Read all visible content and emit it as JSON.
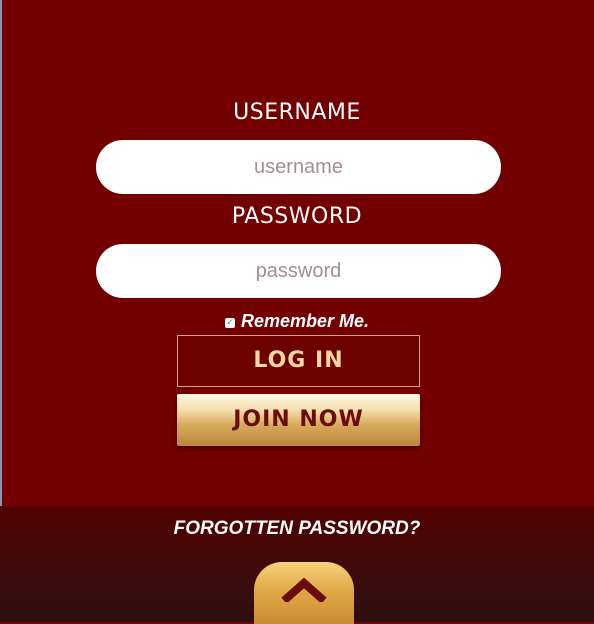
{
  "form": {
    "username_label": "USERNAME",
    "username_placeholder": "username",
    "password_label": "PASSWORD",
    "password_placeholder": "password",
    "remember_label": "Remember Me.",
    "remember_checked": true,
    "login_label": "LOG IN",
    "join_label": "JOIN NOW"
  },
  "footer": {
    "forgot_label": "FORGOTTEN PASSWORD?",
    "scroll_icon": "chevron-up-icon"
  },
  "colors": {
    "background": "#730000",
    "login_border": "#d6a55e",
    "login_text": "#f6d7a0",
    "join_text": "#6a0c0c",
    "gold": "#e0a645"
  }
}
